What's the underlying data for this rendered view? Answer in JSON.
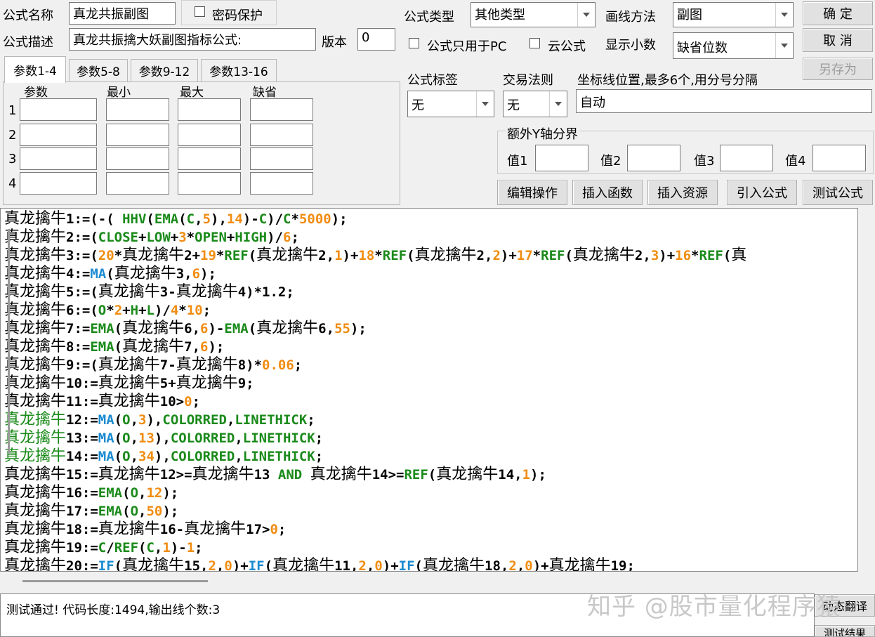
{
  "top": {
    "name_label": "公式名称",
    "name_value": "真龙共振副图",
    "password_label": "密码保护",
    "desc_label": "公式描述",
    "desc_value": "真龙共振擒大妖副图指标公式:",
    "version_label": "版本",
    "version_value": "0",
    "type_label": "公式类型",
    "type_value": "其他类型",
    "draw_label": "画线方法",
    "draw_value": "副图",
    "pc_only_label": "公式只用于PC",
    "cloud_label": "云公式",
    "decimal_label": "显示小数",
    "decimal_value": "缺省位数",
    "tag_label": "公式标签",
    "tag_value": "无",
    "rule_label": "交易法则",
    "rule_value": "无",
    "axis_label": "坐标线位置,最多6个,用分号分隔",
    "axis_value": "自动"
  },
  "buttons": {
    "ok": "确  定",
    "cancel": "取  消",
    "save_as": "另存为",
    "edit": "编辑操作",
    "insert_func": "插入函数",
    "insert_res": "插入资源",
    "import": "引入公式",
    "test": "测试公式",
    "translate": "动态翻译",
    "test_result": "测试结果"
  },
  "tabs": [
    "参数1-4",
    "参数5-8",
    "参数9-12",
    "参数13-16"
  ],
  "params": {
    "headers": [
      "参数",
      "最小",
      "最大",
      "缺省"
    ],
    "rows": [
      "1",
      "2",
      "3",
      "4"
    ]
  },
  "yaxis": {
    "title": "额外Y轴分界",
    "v1": "值1",
    "v2": "值2",
    "v3": "值3",
    "v4": "值4"
  },
  "code_lines": [
    [
      [
        "真龙擒牛",
        "zh"
      ],
      [
        "1:=(-( ",
        "k"
      ],
      [
        "HHV",
        "g"
      ],
      [
        "(",
        "k"
      ],
      [
        "EMA",
        "g"
      ],
      [
        "(",
        "k"
      ],
      [
        "C",
        "g"
      ],
      [
        ",",
        "k"
      ],
      [
        "5",
        "o"
      ],
      [
        "),",
        "k"
      ],
      [
        "14",
        "o"
      ],
      [
        ")-",
        "k"
      ],
      [
        "C",
        "g"
      ],
      [
        ")/",
        "k"
      ],
      [
        "C",
        "g"
      ],
      [
        "*",
        "k"
      ],
      [
        "5000",
        "o"
      ],
      [
        ");",
        "k"
      ]
    ],
    [
      [
        "真龙擒牛",
        "zh"
      ],
      [
        "2:=(",
        "k"
      ],
      [
        "CLOSE",
        "g"
      ],
      [
        "+",
        "k"
      ],
      [
        "LOW",
        "g"
      ],
      [
        "+",
        "k"
      ],
      [
        "3",
        "o"
      ],
      [
        "*",
        "k"
      ],
      [
        "OPEN",
        "g"
      ],
      [
        "+",
        "k"
      ],
      [
        "HIGH",
        "g"
      ],
      [
        ")/",
        "k"
      ],
      [
        "6",
        "o"
      ],
      [
        ";",
        "k"
      ]
    ],
    [
      [
        "真龙擒牛",
        "zh"
      ],
      [
        "3:=(",
        "k"
      ],
      [
        "20",
        "o"
      ],
      [
        "*",
        "k"
      ],
      [
        "真龙擒牛",
        "zh"
      ],
      [
        "2+",
        "k"
      ],
      [
        "19",
        "o"
      ],
      [
        "*",
        "k"
      ],
      [
        "REF",
        "g"
      ],
      [
        "(",
        "k"
      ],
      [
        "真龙擒牛",
        "zh"
      ],
      [
        "2,",
        "k"
      ],
      [
        "1",
        "o"
      ],
      [
        ")+",
        "k"
      ],
      [
        "18",
        "o"
      ],
      [
        "*",
        "k"
      ],
      [
        "REF",
        "g"
      ],
      [
        "(",
        "k"
      ],
      [
        "真龙擒牛",
        "zh"
      ],
      [
        "2,",
        "k"
      ],
      [
        "2",
        "o"
      ],
      [
        ")+",
        "k"
      ],
      [
        "17",
        "o"
      ],
      [
        "*",
        "k"
      ],
      [
        "REF",
        "g"
      ],
      [
        "(",
        "k"
      ],
      [
        "真龙擒牛",
        "zh"
      ],
      [
        "2,",
        "k"
      ],
      [
        "3",
        "o"
      ],
      [
        ")+",
        "k"
      ],
      [
        "16",
        "o"
      ],
      [
        "*",
        "k"
      ],
      [
        "REF",
        "g"
      ],
      [
        "(",
        "k"
      ],
      [
        "真",
        "zh"
      ]
    ],
    [
      [
        "真龙擒牛",
        "zh"
      ],
      [
        "4:=",
        "k"
      ],
      [
        "MA",
        "b"
      ],
      [
        "(",
        "k"
      ],
      [
        "真龙擒牛",
        "zh"
      ],
      [
        "3,",
        "k"
      ],
      [
        "6",
        "o"
      ],
      [
        ");",
        "k"
      ]
    ],
    [
      [
        "真龙擒牛",
        "zh"
      ],
      [
        "5:=(",
        "k"
      ],
      [
        "真龙擒牛",
        "zh"
      ],
      [
        "3-",
        "k"
      ],
      [
        "真龙擒牛",
        "zh"
      ],
      [
        "4)*1.2;",
        "k"
      ]
    ],
    [
      [
        "真龙擒牛",
        "zh"
      ],
      [
        "6:=(",
        "k"
      ],
      [
        "O",
        "g"
      ],
      [
        "*",
        "k"
      ],
      [
        "2",
        "o"
      ],
      [
        "+",
        "k"
      ],
      [
        "H",
        "g"
      ],
      [
        "+",
        "k"
      ],
      [
        "L",
        "g"
      ],
      [
        ")/",
        "k"
      ],
      [
        "4",
        "o"
      ],
      [
        "*",
        "k"
      ],
      [
        "10",
        "o"
      ],
      [
        ";",
        "k"
      ]
    ],
    [
      [
        "真龙擒牛",
        "zh"
      ],
      [
        "7:=",
        "k"
      ],
      [
        "EMA",
        "g"
      ],
      [
        "(",
        "k"
      ],
      [
        "真龙擒牛",
        "zh"
      ],
      [
        "6,",
        "k"
      ],
      [
        "6",
        "o"
      ],
      [
        ")-",
        "k"
      ],
      [
        "EMA",
        "g"
      ],
      [
        "(",
        "k"
      ],
      [
        "真龙擒牛",
        "zh"
      ],
      [
        "6,",
        "k"
      ],
      [
        "55",
        "o"
      ],
      [
        ");",
        "k"
      ]
    ],
    [
      [
        "真龙擒牛",
        "zh"
      ],
      [
        "8:=",
        "k"
      ],
      [
        "EMA",
        "g"
      ],
      [
        "(",
        "k"
      ],
      [
        "真龙擒牛",
        "zh"
      ],
      [
        "7,",
        "k"
      ],
      [
        "6",
        "o"
      ],
      [
        ");",
        "k"
      ]
    ],
    [
      [
        "真龙擒牛",
        "zh"
      ],
      [
        "9:=(",
        "k"
      ],
      [
        "真龙擒牛",
        "zh"
      ],
      [
        "7-",
        "k"
      ],
      [
        "真龙擒牛",
        "zh"
      ],
      [
        "8)*",
        "k"
      ],
      [
        "0.06",
        "o"
      ],
      [
        ";",
        "k"
      ]
    ],
    [
      [
        "真龙擒牛",
        "zh"
      ],
      [
        "10:=",
        "k"
      ],
      [
        "真龙擒牛",
        "zh"
      ],
      [
        "5+",
        "k"
      ],
      [
        "真龙擒牛",
        "zh"
      ],
      [
        "9;",
        "k"
      ]
    ],
    [
      [
        "真龙擒牛",
        "zh"
      ],
      [
        "11:=",
        "k"
      ],
      [
        "真龙擒牛",
        "zh"
      ],
      [
        "10>",
        "k"
      ],
      [
        "0",
        "o"
      ],
      [
        ";",
        "k"
      ]
    ],
    [
      [
        "真龙擒牛",
        "zhg"
      ],
      [
        "12:=",
        "k"
      ],
      [
        "MA",
        "b"
      ],
      [
        "(",
        "k"
      ],
      [
        "O",
        "g"
      ],
      [
        ",",
        "k"
      ],
      [
        "3",
        "o"
      ],
      [
        "),",
        "k"
      ],
      [
        "COLORRED",
        "g"
      ],
      [
        ",",
        "k"
      ],
      [
        "LINETHICK",
        "g"
      ],
      [
        ";",
        "k"
      ]
    ],
    [
      [
        "真龙擒牛",
        "zhg"
      ],
      [
        "13:=",
        "k"
      ],
      [
        "MA",
        "b"
      ],
      [
        "(",
        "k"
      ],
      [
        "O",
        "g"
      ],
      [
        ",",
        "k"
      ],
      [
        "13",
        "o"
      ],
      [
        "),",
        "k"
      ],
      [
        "COLORRED",
        "g"
      ],
      [
        ",",
        "k"
      ],
      [
        "LINETHICK",
        "g"
      ],
      [
        ";",
        "k"
      ]
    ],
    [
      [
        "真龙擒牛",
        "zhg"
      ],
      [
        "14:=",
        "k"
      ],
      [
        "MA",
        "b"
      ],
      [
        "(",
        "k"
      ],
      [
        "O",
        "g"
      ],
      [
        ",",
        "k"
      ],
      [
        "34",
        "o"
      ],
      [
        "),",
        "k"
      ],
      [
        "COLORRED",
        "g"
      ],
      [
        ",",
        "k"
      ],
      [
        "LINETHICK",
        "g"
      ],
      [
        ";",
        "k"
      ]
    ],
    [
      [
        "真龙擒牛",
        "zh"
      ],
      [
        "15:=",
        "k"
      ],
      [
        "真龙擒牛",
        "zh"
      ],
      [
        "12>=",
        "k"
      ],
      [
        "真龙擒牛",
        "zh"
      ],
      [
        "13 ",
        "k"
      ],
      [
        "AND",
        "g"
      ],
      [
        " ",
        "k"
      ],
      [
        "真龙擒牛",
        "zh"
      ],
      [
        "14>=",
        "k"
      ],
      [
        "REF",
        "g"
      ],
      [
        "(",
        "k"
      ],
      [
        "真龙擒牛",
        "zh"
      ],
      [
        "14,",
        "k"
      ],
      [
        "1",
        "o"
      ],
      [
        ");",
        "k"
      ]
    ],
    [
      [
        "真龙擒牛",
        "zh"
      ],
      [
        "16:=",
        "k"
      ],
      [
        "EMA",
        "g"
      ],
      [
        "(",
        "k"
      ],
      [
        "O",
        "g"
      ],
      [
        ",",
        "k"
      ],
      [
        "12",
        "o"
      ],
      [
        ");",
        "k"
      ]
    ],
    [
      [
        "真龙擒牛",
        "zh"
      ],
      [
        "17:=",
        "k"
      ],
      [
        "EMA",
        "g"
      ],
      [
        "(",
        "k"
      ],
      [
        "O",
        "g"
      ],
      [
        ",",
        "k"
      ],
      [
        "50",
        "o"
      ],
      [
        ");",
        "k"
      ]
    ],
    [
      [
        "真龙擒牛",
        "zh"
      ],
      [
        "18:=",
        "k"
      ],
      [
        "真龙擒牛",
        "zh"
      ],
      [
        "16-",
        "k"
      ],
      [
        "真龙擒牛",
        "zh"
      ],
      [
        "17>",
        "k"
      ],
      [
        "0",
        "o"
      ],
      [
        ";",
        "k"
      ]
    ],
    [
      [
        "真龙擒牛",
        "zh"
      ],
      [
        "19:=",
        "k"
      ],
      [
        "C",
        "g"
      ],
      [
        "/",
        "k"
      ],
      [
        "REF",
        "g"
      ],
      [
        "(",
        "k"
      ],
      [
        "C",
        "g"
      ],
      [
        ",",
        "k"
      ],
      [
        "1",
        "o"
      ],
      [
        ")-",
        "k"
      ],
      [
        "1",
        "o"
      ],
      [
        ";",
        "k"
      ]
    ],
    [
      [
        "真龙擒牛",
        "zh"
      ],
      [
        "20:=",
        "k"
      ],
      [
        "IF",
        "b"
      ],
      [
        "(",
        "k"
      ],
      [
        "真龙擒牛",
        "zh"
      ],
      [
        "15,",
        "k"
      ],
      [
        "2",
        "o"
      ],
      [
        ",",
        "k"
      ],
      [
        "0",
        "o"
      ],
      [
        ")+",
        "k"
      ],
      [
        "IF",
        "b"
      ],
      [
        "(",
        "k"
      ],
      [
        "真龙擒牛",
        "zh"
      ],
      [
        "11,",
        "k"
      ],
      [
        "2",
        "o"
      ],
      [
        ",",
        "k"
      ],
      [
        "0",
        "o"
      ],
      [
        ")+",
        "k"
      ],
      [
        "IF",
        "b"
      ],
      [
        "(",
        "k"
      ],
      [
        "真龙擒牛",
        "zh"
      ],
      [
        "18,",
        "k"
      ],
      [
        "2",
        "o"
      ],
      [
        ",",
        "k"
      ],
      [
        "0",
        "o"
      ],
      [
        ")+",
        "k"
      ],
      [
        "真龙擒牛",
        "zh"
      ],
      [
        "19;",
        "k"
      ]
    ]
  ],
  "status_text": "测试通过! 代码长度:1494,输出线个数:3",
  "watermark": "知乎 @股市量化程序猿"
}
